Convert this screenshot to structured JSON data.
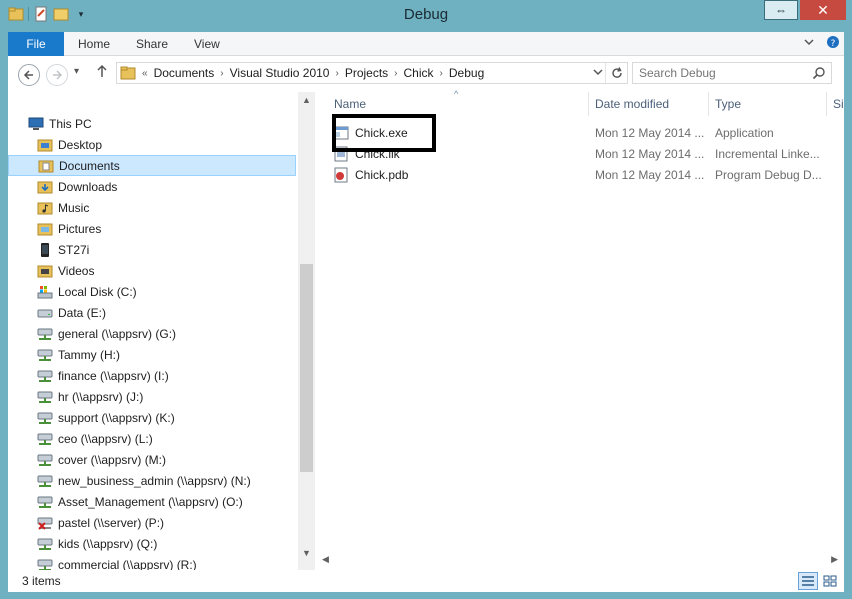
{
  "window": {
    "title": "Debug"
  },
  "window_controls": {
    "restore": "⇔",
    "minimize": "—",
    "close": "✕"
  },
  "ribbon": {
    "tabs": [
      {
        "label": "File"
      },
      {
        "label": "Home"
      },
      {
        "label": "Share"
      },
      {
        "label": "View"
      }
    ]
  },
  "address": {
    "overflow": "«",
    "crumbs": [
      "Documents",
      "Visual Studio 2010",
      "Projects",
      "Chick",
      "Debug"
    ]
  },
  "search": {
    "placeholder": "Search Debug"
  },
  "navigation": {
    "root": "This PC",
    "items": [
      {
        "label": "Desktop",
        "icon": "desktop-folder-icon"
      },
      {
        "label": "Documents",
        "icon": "documents-folder-icon",
        "selected": true
      },
      {
        "label": "Downloads",
        "icon": "downloads-folder-icon"
      },
      {
        "label": "Music",
        "icon": "music-folder-icon"
      },
      {
        "label": "Pictures",
        "icon": "pictures-folder-icon"
      },
      {
        "label": "ST27i",
        "icon": "phone-icon"
      },
      {
        "label": "Videos",
        "icon": "videos-folder-icon"
      },
      {
        "label": "Local Disk (C:)",
        "icon": "system-drive-icon"
      },
      {
        "label": "Data (E:)",
        "icon": "drive-icon"
      },
      {
        "label": "general (\\\\appsrv) (G:)",
        "icon": "network-drive-icon"
      },
      {
        "label": "Tammy (H:)",
        "icon": "network-drive-icon"
      },
      {
        "label": "finance (\\\\appsrv) (I:)",
        "icon": "network-drive-icon"
      },
      {
        "label": "hr (\\\\appsrv) (J:)",
        "icon": "network-drive-icon"
      },
      {
        "label": "support (\\\\appsrv) (K:)",
        "icon": "network-drive-icon"
      },
      {
        "label": "ceo (\\\\appsrv) (L:)",
        "icon": "network-drive-icon"
      },
      {
        "label": "cover (\\\\appsrv) (M:)",
        "icon": "network-drive-icon"
      },
      {
        "label": "new_business_admin (\\\\appsrv) (N:)",
        "icon": "network-drive-icon"
      },
      {
        "label": "Asset_Management (\\\\appsrv) (O:)",
        "icon": "network-drive-icon"
      },
      {
        "label": "pastel (\\\\server) (P:)",
        "icon": "disconnected-network-drive-icon"
      },
      {
        "label": "kids (\\\\appsrv) (Q:)",
        "icon": "network-drive-icon"
      },
      {
        "label": "commercial (\\\\appsrv) (R:)",
        "icon": "network-drive-icon"
      }
    ]
  },
  "columns": [
    {
      "label": "Name"
    },
    {
      "label": "Date modified"
    },
    {
      "label": "Type"
    },
    {
      "label": "Si"
    }
  ],
  "files": [
    {
      "name": "Chick.exe",
      "date": "Mon 12 May 2014 ...",
      "type": "Application",
      "icon": "application-icon"
    },
    {
      "name": "Chick.ilk",
      "date": "Mon 12 May 2014 ...",
      "type": "Incremental Linke...",
      "icon": "ilk-file-icon"
    },
    {
      "name": "Chick.pdb",
      "date": "Mon 12 May 2014 ...",
      "type": "Program Debug D...",
      "icon": "pdb-file-icon"
    }
  ],
  "status": {
    "count": "3 items"
  },
  "colors": {
    "frame": "#6fb1c0",
    "file_tab": "#1979ca",
    "close_button": "#c74a41",
    "selection": "#cce8ff",
    "highlight_box": "#000000"
  }
}
